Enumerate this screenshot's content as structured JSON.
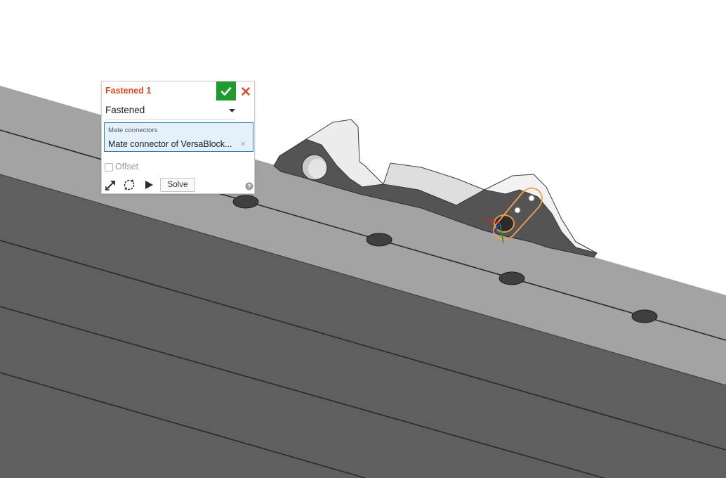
{
  "mate_panel": {
    "title": "Fastened 1",
    "mate_type": "Fastened",
    "mate_connectors_label": "Mate connectors",
    "mate_connector_value": "Mate connector of VersaBlock...",
    "offset_label": "Offset",
    "offset_checked": false,
    "solve_label": "Solve",
    "accept_icon": "checkmark-icon",
    "cancel_icon": "close-icon",
    "tools": [
      "flip-primary-axis-icon",
      "reorient-secondary-axis-icon",
      "animate-play-icon"
    ],
    "help_icon": "help-icon"
  },
  "colors": {
    "title": "#d84a22",
    "accept": "#1f9a2f",
    "cancel": "#d84a22",
    "selection": "#2f7bb6",
    "highlight_connector": "#f0a050",
    "rail_top": "#a3a3a3",
    "rail_side": "#5f5f5f",
    "part_white": "#ececec",
    "part_dark": "#545454"
  }
}
